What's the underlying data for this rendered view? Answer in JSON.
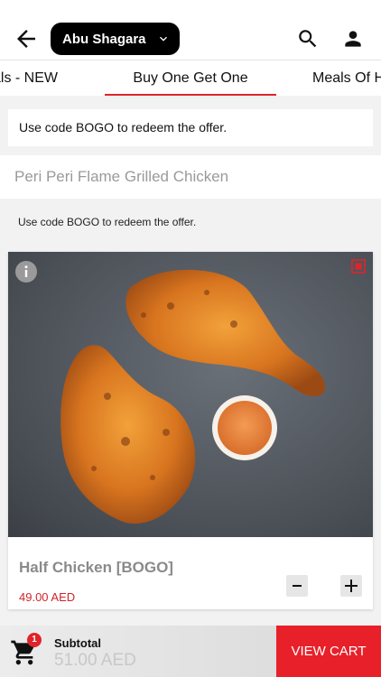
{
  "header": {
    "branch_name": "Abu Shagara",
    "icons": [
      "arrow-left-icon",
      "chevron-down-icon",
      "search-icon",
      "person-icon"
    ]
  },
  "tabs": [
    {
      "label": "Meals - NEW",
      "visible_text": "als - NEW",
      "active": false
    },
    {
      "label": "Buy One Get One",
      "visible_text": "Buy One Get One",
      "active": true
    },
    {
      "label": "Meals Of H",
      "visible_text": "Meals Of H",
      "active": false
    }
  ],
  "notice": {
    "text": "Use code BOGO to redeem the offer."
  },
  "category": {
    "title": "Peri Peri Flame Grilled Chicken",
    "description": "Use code BOGO to redeem the offer."
  },
  "product": {
    "name": "Half Chicken [BOGO]",
    "price": "49.00 AED",
    "minus_label": "−",
    "plus_label": "+"
  },
  "cart": {
    "count": "1",
    "subtotal_label": "Subtotal",
    "subtotal_value": "51.00 AED",
    "view_cart_label": "VIEW CART"
  },
  "colors": {
    "accent": "#e8202a",
    "header_pill": "#000000",
    "price": "#d0242a"
  }
}
